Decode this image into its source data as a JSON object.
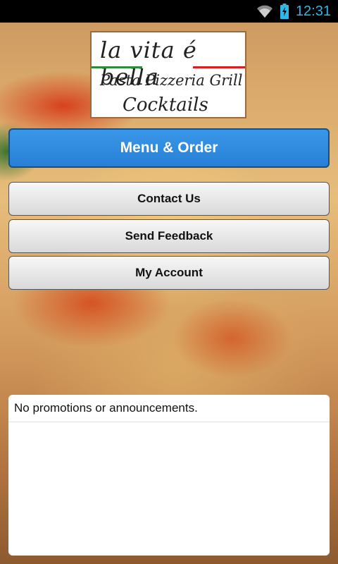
{
  "status_bar": {
    "time": "12:31",
    "icons": [
      "wifi-icon",
      "battery-charging-icon"
    ],
    "accent_color": "#33b5e5"
  },
  "logo": {
    "line1": "la vita é bella",
    "line2": "Pasta Pizzeria Grill",
    "line3": "Cocktails"
  },
  "buttons": {
    "menu_order": "Menu & Order",
    "contact_us": "Contact Us",
    "send_feedback": "Send Feedback",
    "my_account": "My Account"
  },
  "promotions": {
    "message": "No promotions or announcements."
  },
  "colors": {
    "primary_button": "#2a86d9",
    "secondary_button": "#e6e6e6"
  }
}
